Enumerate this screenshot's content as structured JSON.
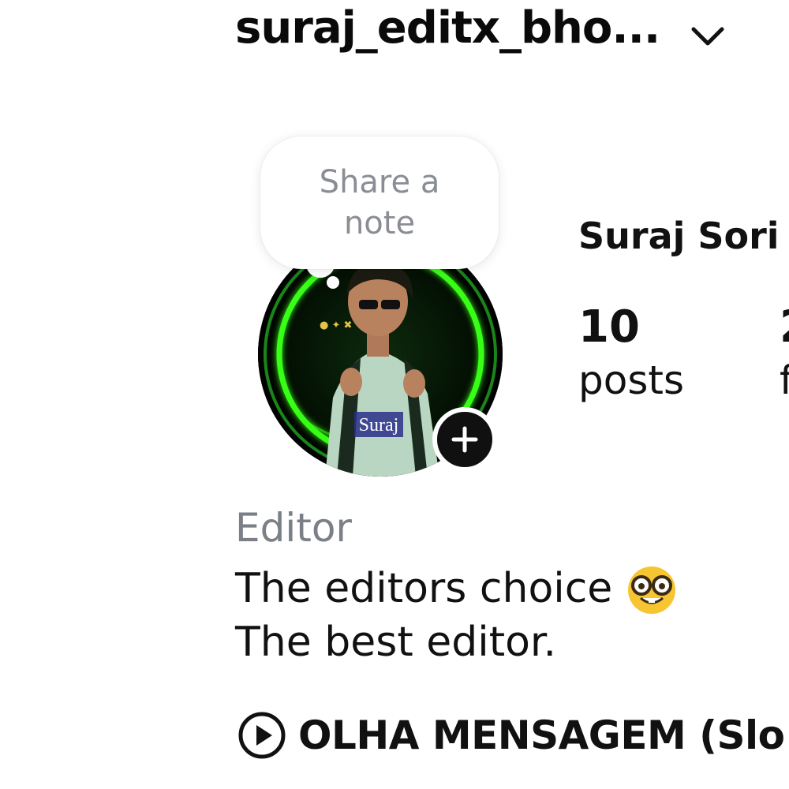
{
  "header": {
    "username": "suraj_editx_bho...",
    "switcher_icon": "chevron-down-icon"
  },
  "note": {
    "placeholder": "Share a note"
  },
  "avatar": {
    "overlay_text": "Suraj",
    "add_story_icon": "plus-icon",
    "ring_color": "#39ff14"
  },
  "profile": {
    "display_name": "Suraj Sori",
    "stats": [
      {
        "value": "10",
        "label": "posts"
      },
      {
        "value": "2",
        "label": "f"
      }
    ]
  },
  "bio": {
    "category": "Editor",
    "lines": [
      "The editors choice",
      "The best editor."
    ],
    "emoji_icon": "nerd-face-icon"
  },
  "music": {
    "icon": "play-circle-icon",
    "title": "OLHA MENSAGEM (Slo"
  }
}
